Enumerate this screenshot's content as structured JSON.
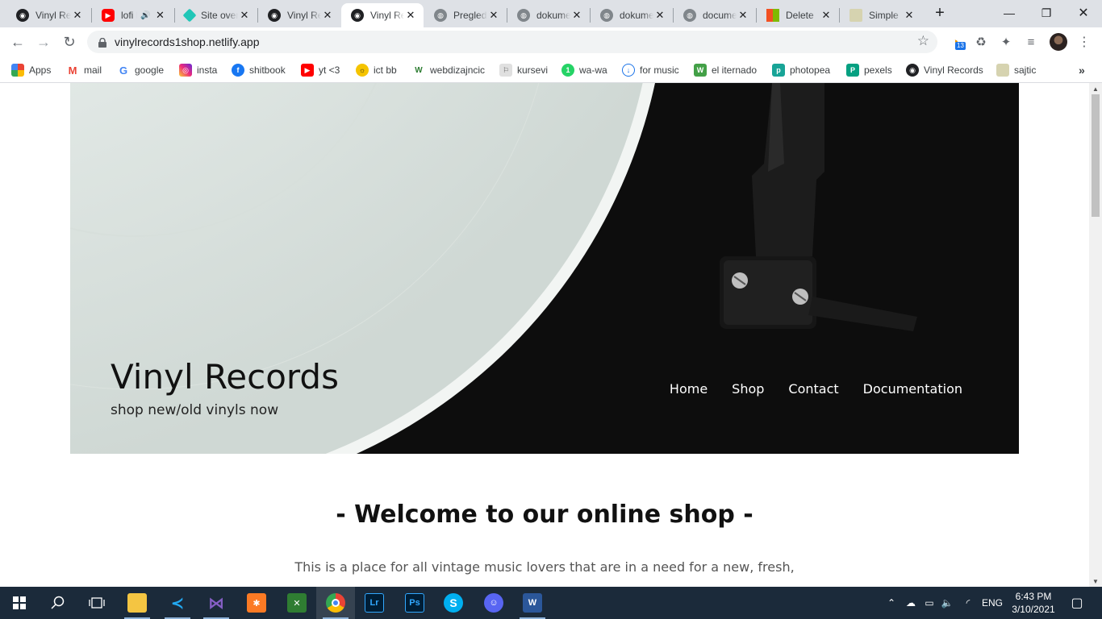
{
  "browser": {
    "tabs": [
      {
        "title": "Vinyl Records",
        "favicon": "vinyl-icon",
        "active": false
      },
      {
        "title": "lofi hip hop",
        "favicon": "youtube-icon",
        "active": false,
        "audio": true
      },
      {
        "title": "Site overview",
        "favicon": "netlify-icon",
        "active": false
      },
      {
        "title": "Vinyl Records",
        "favicon": "vinyl-icon",
        "active": false
      },
      {
        "title": "Vinyl Records",
        "favicon": "vinyl-icon",
        "active": true
      },
      {
        "title": "Pregled",
        "favicon": "globe-icon",
        "active": false
      },
      {
        "title": "dokumentacija",
        "favicon": "globe-icon",
        "active": false
      },
      {
        "title": "dokumentacija",
        "favicon": "globe-icon",
        "active": false
      },
      {
        "title": "documentation",
        "favicon": "globe-icon",
        "active": false
      },
      {
        "title": "Delete",
        "favicon": "microsoft-icon",
        "active": false
      },
      {
        "title": "Simple",
        "favicon": "image-icon",
        "active": false
      }
    ],
    "url": "vinylrecords1shop.netlify.app",
    "extension_badge": "13",
    "bookmarks": [
      {
        "label": "Apps",
        "icon": "apps-grid-icon"
      },
      {
        "label": "mail",
        "icon": "gmail-icon"
      },
      {
        "label": "google",
        "icon": "google-icon"
      },
      {
        "label": "insta",
        "icon": "instagram-icon"
      },
      {
        "label": "shitbook",
        "icon": "facebook-icon"
      },
      {
        "label": "yt <3",
        "icon": "youtube-icon"
      },
      {
        "label": "ict bb",
        "icon": "ict-icon"
      },
      {
        "label": "webdizajncic",
        "icon": "wd-icon"
      },
      {
        "label": "kursevi",
        "icon": "kursevi-icon"
      },
      {
        "label": "wa-wa",
        "icon": "whatsapp-icon"
      },
      {
        "label": "for music",
        "icon": "download-icon"
      },
      {
        "label": "el iternado",
        "icon": "w-icon"
      },
      {
        "label": "photopea",
        "icon": "photopea-icon"
      },
      {
        "label": "pexels",
        "icon": "pexels-icon"
      },
      {
        "label": "Vinyl Records",
        "icon": "vinyl-icon"
      },
      {
        "label": "sajtic",
        "icon": "image-icon"
      }
    ],
    "bookmarks_overflow": "»"
  },
  "page": {
    "site_title": "Vinyl Records",
    "tagline": "shop new/old vinyls now",
    "nav": [
      "Home",
      "Shop",
      "Contact",
      "Documentation"
    ],
    "welcome_heading": "- Welcome to our online shop -",
    "intro_text": "This is a place for all vintage music lovers that are in a need for a new, fresh,"
  },
  "taskbar": {
    "apps": [
      "start-icon",
      "search-icon",
      "task-view-icon",
      "file-explorer-icon",
      "vscode-icon",
      "visual-studio-icon",
      "xampp-icon",
      "app-icon",
      "chrome-icon",
      "lightroom-icon",
      "photoshop-icon",
      "skype-icon",
      "discord-icon",
      "word-icon"
    ],
    "language": "ENG",
    "time": "6:43 PM",
    "date": "3/10/2021"
  },
  "colors": {
    "accent": "#1a73e8",
    "tabstrip": "#dee1e6",
    "taskbar": "#1b2a3a",
    "hero_dark": "#0d0d0d",
    "hero_light": "#e3e9e6"
  }
}
